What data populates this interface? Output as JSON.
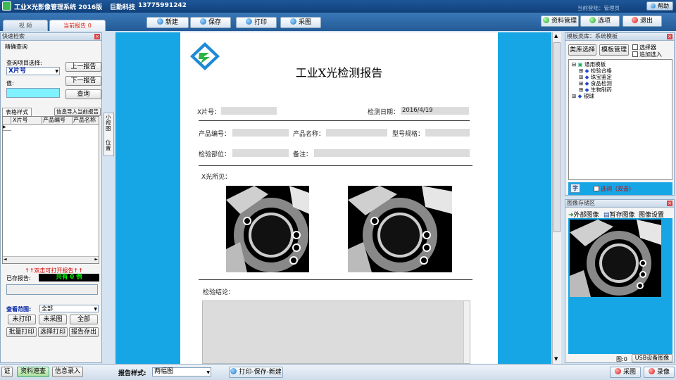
{
  "window": {
    "title": "工业X光影像管理系统 2016版",
    "company": "巨勤科技",
    "phone": "13775991242",
    "help": "帮助"
  },
  "tabs": [
    {
      "label": "视 频"
    },
    {
      "label": "当前报告 0"
    }
  ],
  "toolbar": {
    "new": "新建",
    "save": "保存",
    "print": "打印",
    "capture": "采图"
  },
  "right_toolbar": {
    "login": "当前登陆：管理员",
    "data_manage": "资料管理",
    "options": "选项",
    "exit": "退出"
  },
  "quick_search": {
    "title": "快速检索",
    "section": "精确查询",
    "item_label": "查询项目选择:",
    "item_value": "X片号",
    "value_label": "值:",
    "prev": "上一报告",
    "next": "下一报告",
    "query": "查询",
    "tab_style": "表格样式",
    "import": "信息导入当前报告",
    "columns": [
      "X片号",
      "产品编号",
      "产品名称"
    ]
  },
  "saved": {
    "hint": "↑↑双击可打开报告↑↑",
    "label": "已存报告:",
    "count": "共有 0 例",
    "range_label": "查看范围:",
    "range_value": "全部",
    "not_printed": "未打印",
    "not_captured": "未采图",
    "all": "全部",
    "batch_print": "批量打印",
    "select_print": "选择打印",
    "report_save": "报告存出"
  },
  "side_tabs": {
    "small_panel": "小视图",
    "position": "位置"
  },
  "report": {
    "title": "工业X光检测报告",
    "x_no": "X片号：",
    "date_label": "检测日期：",
    "date_value": "2016/4/19",
    "product_no": "产品编号：",
    "product_name": "产品名称：",
    "spec": "型号规格：",
    "part": "检验部位：",
    "remark": "备注：",
    "findings": "X光所见：",
    "conclusion": "检验结论："
  },
  "template_panel": {
    "title": "模板类库：系统模板",
    "library_btn": "类库选择",
    "manage_btn": "模板管理",
    "selector": "选择器",
    "append": "追加选入",
    "tree": [
      {
        "label": "通用模板",
        "level": 0
      },
      {
        "label": "检验合格",
        "level": 1
      },
      {
        "label": "珠宝鉴定",
        "level": 1
      },
      {
        "label": "食品检测",
        "level": 1
      },
      {
        "label": "生物制药",
        "level": 1
      },
      {
        "label": "银球",
        "level": 0
      }
    ],
    "font_icon": "字",
    "select_label": "选词（双击）"
  },
  "image_panel": {
    "title": "图像存储区",
    "external": "外部图像",
    "pause": "暂存图像",
    "settings": "图像设置",
    "count": "图:0",
    "usb": "USB设备图像"
  },
  "bottom": {
    "cert": "证",
    "quick_query": "资料速查",
    "info_entry": "信息录入",
    "style_label": "报告样式:",
    "style_value": "两幅图",
    "print_save_new": "打印-保存-新建",
    "capture": "采图",
    "record": "录像"
  },
  "colors": {
    "accent_blue": "#16a6e6",
    "title_blue": "#1e5799",
    "count_green": "#00ff00"
  }
}
